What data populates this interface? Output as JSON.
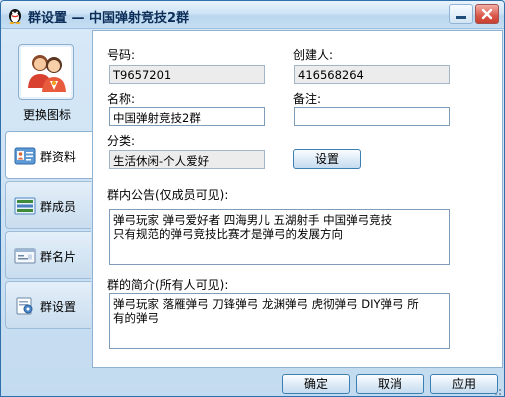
{
  "window": {
    "title": "群设置 — 中国弹射竞技2群",
    "accent": "#2f6fab"
  },
  "sidebar": {
    "change_icon_label": "更换图标",
    "items": [
      {
        "label": "群资料",
        "icon": "group-info-icon",
        "active": true
      },
      {
        "label": "群成员",
        "icon": "members-icon",
        "active": false
      },
      {
        "label": "群名片",
        "icon": "card-icon",
        "active": false
      },
      {
        "label": "群设置",
        "icon": "settings-icon",
        "active": false
      }
    ]
  },
  "form": {
    "number_label": "号码:",
    "number_value": "T9657201",
    "creator_label": "创建人:",
    "creator_value": "416568264",
    "name_label": "名称:",
    "name_value": "中国弹射竞技2群",
    "remark_label": "备注:",
    "remark_value": "",
    "category_label": "分类:",
    "category_value": "生活休闲-个人爱好",
    "set_button": "设置",
    "notice_label": "群内公告(仅成员可见):",
    "notice_line1": "弹弓玩家 弹弓爱好者 四海男儿 五湖射手 中国弹弓竞技",
    "notice_line2": "只有规范的弹弓竞技比赛才是弹弓的发展方向",
    "intro_label": "群的简介(所有人可见):",
    "intro_line1": "弹弓玩家 落雁弹弓 刀锋弹弓 龙渊弹弓 虎彻弹弓 DIY弹弓 所",
    "intro_line2": "有的弹弓"
  },
  "footer": {
    "ok": "确定",
    "cancel": "取消",
    "apply": "应用"
  }
}
